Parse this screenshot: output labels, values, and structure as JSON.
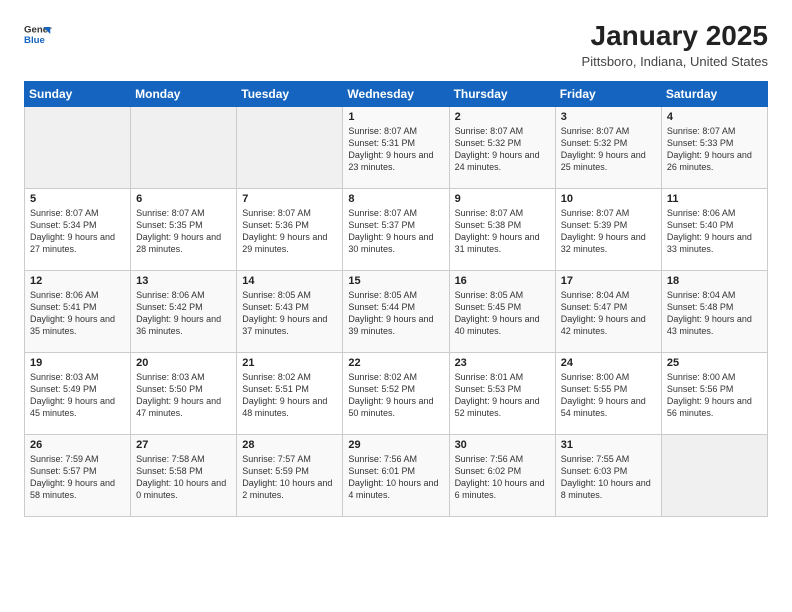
{
  "header": {
    "logo_general": "General",
    "logo_blue": "Blue",
    "month_title": "January 2025",
    "location": "Pittsboro, Indiana, United States"
  },
  "days_of_week": [
    "Sunday",
    "Monday",
    "Tuesday",
    "Wednesday",
    "Thursday",
    "Friday",
    "Saturday"
  ],
  "weeks": [
    [
      {
        "day": "",
        "empty": true
      },
      {
        "day": "",
        "empty": true
      },
      {
        "day": "",
        "empty": true
      },
      {
        "day": "1",
        "sunrise": "8:07 AM",
        "sunset": "5:31 PM",
        "daylight": "9 hours and 23 minutes."
      },
      {
        "day": "2",
        "sunrise": "8:07 AM",
        "sunset": "5:32 PM",
        "daylight": "9 hours and 24 minutes."
      },
      {
        "day": "3",
        "sunrise": "8:07 AM",
        "sunset": "5:32 PM",
        "daylight": "9 hours and 25 minutes."
      },
      {
        "day": "4",
        "sunrise": "8:07 AM",
        "sunset": "5:33 PM",
        "daylight": "9 hours and 26 minutes."
      }
    ],
    [
      {
        "day": "5",
        "sunrise": "8:07 AM",
        "sunset": "5:34 PM",
        "daylight": "9 hours and 27 minutes."
      },
      {
        "day": "6",
        "sunrise": "8:07 AM",
        "sunset": "5:35 PM",
        "daylight": "9 hours and 28 minutes."
      },
      {
        "day": "7",
        "sunrise": "8:07 AM",
        "sunset": "5:36 PM",
        "daylight": "9 hours and 29 minutes."
      },
      {
        "day": "8",
        "sunrise": "8:07 AM",
        "sunset": "5:37 PM",
        "daylight": "9 hours and 30 minutes."
      },
      {
        "day": "9",
        "sunrise": "8:07 AM",
        "sunset": "5:38 PM",
        "daylight": "9 hours and 31 minutes."
      },
      {
        "day": "10",
        "sunrise": "8:07 AM",
        "sunset": "5:39 PM",
        "daylight": "9 hours and 32 minutes."
      },
      {
        "day": "11",
        "sunrise": "8:06 AM",
        "sunset": "5:40 PM",
        "daylight": "9 hours and 33 minutes."
      }
    ],
    [
      {
        "day": "12",
        "sunrise": "8:06 AM",
        "sunset": "5:41 PM",
        "daylight": "9 hours and 35 minutes."
      },
      {
        "day": "13",
        "sunrise": "8:06 AM",
        "sunset": "5:42 PM",
        "daylight": "9 hours and 36 minutes."
      },
      {
        "day": "14",
        "sunrise": "8:05 AM",
        "sunset": "5:43 PM",
        "daylight": "9 hours and 37 minutes."
      },
      {
        "day": "15",
        "sunrise": "8:05 AM",
        "sunset": "5:44 PM",
        "daylight": "9 hours and 39 minutes."
      },
      {
        "day": "16",
        "sunrise": "8:05 AM",
        "sunset": "5:45 PM",
        "daylight": "9 hours and 40 minutes."
      },
      {
        "day": "17",
        "sunrise": "8:04 AM",
        "sunset": "5:47 PM",
        "daylight": "9 hours and 42 minutes."
      },
      {
        "day": "18",
        "sunrise": "8:04 AM",
        "sunset": "5:48 PM",
        "daylight": "9 hours and 43 minutes."
      }
    ],
    [
      {
        "day": "19",
        "sunrise": "8:03 AM",
        "sunset": "5:49 PM",
        "daylight": "9 hours and 45 minutes."
      },
      {
        "day": "20",
        "sunrise": "8:03 AM",
        "sunset": "5:50 PM",
        "daylight": "9 hours and 47 minutes."
      },
      {
        "day": "21",
        "sunrise": "8:02 AM",
        "sunset": "5:51 PM",
        "daylight": "9 hours and 48 minutes."
      },
      {
        "day": "22",
        "sunrise": "8:02 AM",
        "sunset": "5:52 PM",
        "daylight": "9 hours and 50 minutes."
      },
      {
        "day": "23",
        "sunrise": "8:01 AM",
        "sunset": "5:53 PM",
        "daylight": "9 hours and 52 minutes."
      },
      {
        "day": "24",
        "sunrise": "8:00 AM",
        "sunset": "5:55 PM",
        "daylight": "9 hours and 54 minutes."
      },
      {
        "day": "25",
        "sunrise": "8:00 AM",
        "sunset": "5:56 PM",
        "daylight": "9 hours and 56 minutes."
      }
    ],
    [
      {
        "day": "26",
        "sunrise": "7:59 AM",
        "sunset": "5:57 PM",
        "daylight": "9 hours and 58 minutes."
      },
      {
        "day": "27",
        "sunrise": "7:58 AM",
        "sunset": "5:58 PM",
        "daylight": "10 hours and 0 minutes."
      },
      {
        "day": "28",
        "sunrise": "7:57 AM",
        "sunset": "5:59 PM",
        "daylight": "10 hours and 2 minutes."
      },
      {
        "day": "29",
        "sunrise": "7:56 AM",
        "sunset": "6:01 PM",
        "daylight": "10 hours and 4 minutes."
      },
      {
        "day": "30",
        "sunrise": "7:56 AM",
        "sunset": "6:02 PM",
        "daylight": "10 hours and 6 minutes."
      },
      {
        "day": "31",
        "sunrise": "7:55 AM",
        "sunset": "6:03 PM",
        "daylight": "10 hours and 8 minutes."
      },
      {
        "day": "",
        "empty": true
      }
    ]
  ],
  "labels": {
    "sunrise": "Sunrise:",
    "sunset": "Sunset:",
    "daylight": "Daylight:"
  }
}
